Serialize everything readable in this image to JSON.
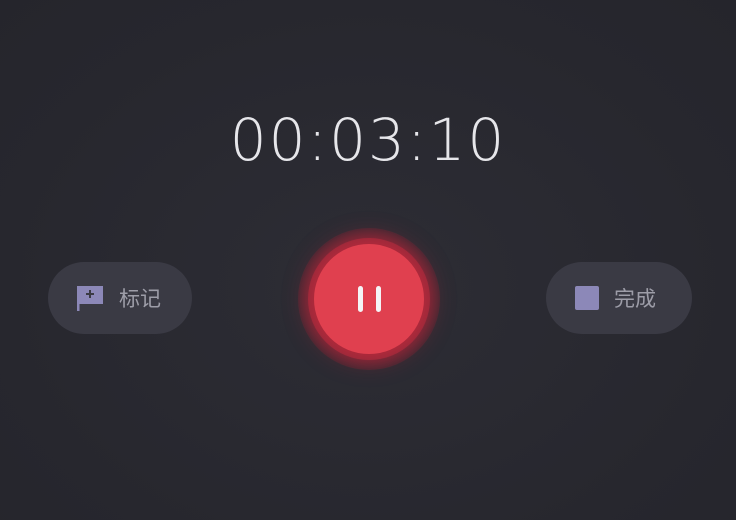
{
  "timer": {
    "elapsed": "00:03:10"
  },
  "controls": {
    "mark_label": "标记",
    "mark_icon": "flag-icon",
    "pause_icon": "pause-icon",
    "done_label": "完成",
    "done_icon": "stop-icon"
  },
  "colors": {
    "background": "#2a2a31",
    "pill": "#3a3a44",
    "record_red": "#e0404f",
    "icon_purple": "#8c88b8"
  }
}
